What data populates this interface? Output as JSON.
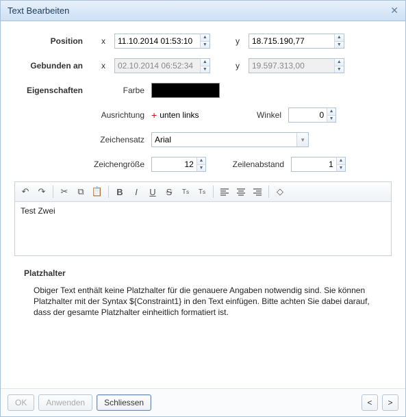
{
  "title": "Text Bearbeiten",
  "position": {
    "label": "Position",
    "x_label": "x",
    "x_value": "11.10.2014 01:53:10",
    "y_label": "y",
    "y_value": "18.715.190,77"
  },
  "bound": {
    "label": "Gebunden an",
    "x_label": "x",
    "x_value": "02.10.2014 06:52:34",
    "y_label": "y",
    "y_value": "19.597.313,00"
  },
  "props": {
    "section": "Eigenschaften",
    "color_label": "Farbe",
    "align_label": "Ausrichtung",
    "align_value": "unten links",
    "angle_label": "Winkel",
    "angle_value": "0",
    "font_label": "Zeichensatz",
    "font_value": "Arial",
    "size_label": "Zeichengröße",
    "size_value": "12",
    "linespace_label": "Zeilenabstand",
    "linespace_value": "1"
  },
  "editor": {
    "content": "Test Zwei"
  },
  "placeholder": {
    "heading": "Platzhalter",
    "text": "Obiger Text enthält keine Platzhalter für die genauere Angaben notwendig sind. Sie können Platzhalter mit der Syntax ${Constraint1} in den Text einfügen. Bitte achten Sie dabei darauf, dass der gesamte Platzhalter einheitlich formatiert ist."
  },
  "buttons": {
    "ok": "OK",
    "apply": "Anwenden",
    "close": "Schliessen",
    "prev": "<",
    "next": ">"
  }
}
